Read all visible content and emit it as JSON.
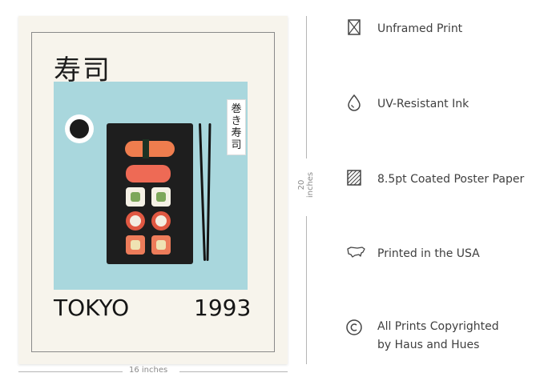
{
  "poster": {
    "kanji_title": "寿司",
    "vertical_label": "巻き寿司",
    "city": "TOKYO",
    "year": "1993"
  },
  "dimensions": {
    "height_label": "20 inches",
    "width_label": "16 inches"
  },
  "features": [
    {
      "icon": "box-x-icon",
      "label": "Unframed Print"
    },
    {
      "icon": "droplet-icon",
      "label": "UV-Resistant Ink"
    },
    {
      "icon": "hatched-square-icon",
      "label": "8.5pt Coated Poster Paper"
    },
    {
      "icon": "usa-map-icon",
      "label": "Printed in the USA"
    },
    {
      "icon": "copyright-icon",
      "label": "All Prints Copyrighted",
      "label2": "by Haus and Hues"
    }
  ],
  "colors": {
    "art_background": "#a9d7dd",
    "poster_paper": "#f7f4ec",
    "text": "#3f3f3f"
  }
}
